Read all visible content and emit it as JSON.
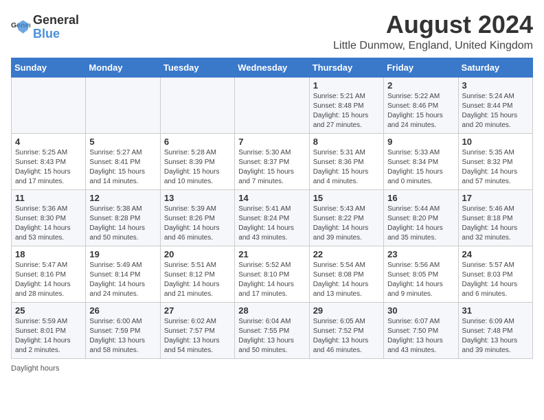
{
  "header": {
    "logo_text_general": "General",
    "logo_text_blue": "Blue",
    "month_year": "August 2024",
    "location": "Little Dunmow, England, United Kingdom"
  },
  "calendar": {
    "days_of_week": [
      "Sunday",
      "Monday",
      "Tuesday",
      "Wednesday",
      "Thursday",
      "Friday",
      "Saturday"
    ],
    "weeks": [
      [
        {
          "day": "",
          "info": ""
        },
        {
          "day": "",
          "info": ""
        },
        {
          "day": "",
          "info": ""
        },
        {
          "day": "",
          "info": ""
        },
        {
          "day": "1",
          "info": "Sunrise: 5:21 AM\nSunset: 8:48 PM\nDaylight: 15 hours and 27 minutes."
        },
        {
          "day": "2",
          "info": "Sunrise: 5:22 AM\nSunset: 8:46 PM\nDaylight: 15 hours and 24 minutes."
        },
        {
          "day": "3",
          "info": "Sunrise: 5:24 AM\nSunset: 8:44 PM\nDaylight: 15 hours and 20 minutes."
        }
      ],
      [
        {
          "day": "4",
          "info": "Sunrise: 5:25 AM\nSunset: 8:43 PM\nDaylight: 15 hours and 17 minutes."
        },
        {
          "day": "5",
          "info": "Sunrise: 5:27 AM\nSunset: 8:41 PM\nDaylight: 15 hours and 14 minutes."
        },
        {
          "day": "6",
          "info": "Sunrise: 5:28 AM\nSunset: 8:39 PM\nDaylight: 15 hours and 10 minutes."
        },
        {
          "day": "7",
          "info": "Sunrise: 5:30 AM\nSunset: 8:37 PM\nDaylight: 15 hours and 7 minutes."
        },
        {
          "day": "8",
          "info": "Sunrise: 5:31 AM\nSunset: 8:36 PM\nDaylight: 15 hours and 4 minutes."
        },
        {
          "day": "9",
          "info": "Sunrise: 5:33 AM\nSunset: 8:34 PM\nDaylight: 15 hours and 0 minutes."
        },
        {
          "day": "10",
          "info": "Sunrise: 5:35 AM\nSunset: 8:32 PM\nDaylight: 14 hours and 57 minutes."
        }
      ],
      [
        {
          "day": "11",
          "info": "Sunrise: 5:36 AM\nSunset: 8:30 PM\nDaylight: 14 hours and 53 minutes."
        },
        {
          "day": "12",
          "info": "Sunrise: 5:38 AM\nSunset: 8:28 PM\nDaylight: 14 hours and 50 minutes."
        },
        {
          "day": "13",
          "info": "Sunrise: 5:39 AM\nSunset: 8:26 PM\nDaylight: 14 hours and 46 minutes."
        },
        {
          "day": "14",
          "info": "Sunrise: 5:41 AM\nSunset: 8:24 PM\nDaylight: 14 hours and 43 minutes."
        },
        {
          "day": "15",
          "info": "Sunrise: 5:43 AM\nSunset: 8:22 PM\nDaylight: 14 hours and 39 minutes."
        },
        {
          "day": "16",
          "info": "Sunrise: 5:44 AM\nSunset: 8:20 PM\nDaylight: 14 hours and 35 minutes."
        },
        {
          "day": "17",
          "info": "Sunrise: 5:46 AM\nSunset: 8:18 PM\nDaylight: 14 hours and 32 minutes."
        }
      ],
      [
        {
          "day": "18",
          "info": "Sunrise: 5:47 AM\nSunset: 8:16 PM\nDaylight: 14 hours and 28 minutes."
        },
        {
          "day": "19",
          "info": "Sunrise: 5:49 AM\nSunset: 8:14 PM\nDaylight: 14 hours and 24 minutes."
        },
        {
          "day": "20",
          "info": "Sunrise: 5:51 AM\nSunset: 8:12 PM\nDaylight: 14 hours and 21 minutes."
        },
        {
          "day": "21",
          "info": "Sunrise: 5:52 AM\nSunset: 8:10 PM\nDaylight: 14 hours and 17 minutes."
        },
        {
          "day": "22",
          "info": "Sunrise: 5:54 AM\nSunset: 8:08 PM\nDaylight: 14 hours and 13 minutes."
        },
        {
          "day": "23",
          "info": "Sunrise: 5:56 AM\nSunset: 8:05 PM\nDaylight: 14 hours and 9 minutes."
        },
        {
          "day": "24",
          "info": "Sunrise: 5:57 AM\nSunset: 8:03 PM\nDaylight: 14 hours and 6 minutes."
        }
      ],
      [
        {
          "day": "25",
          "info": "Sunrise: 5:59 AM\nSunset: 8:01 PM\nDaylight: 14 hours and 2 minutes."
        },
        {
          "day": "26",
          "info": "Sunrise: 6:00 AM\nSunset: 7:59 PM\nDaylight: 13 hours and 58 minutes."
        },
        {
          "day": "27",
          "info": "Sunrise: 6:02 AM\nSunset: 7:57 PM\nDaylight: 13 hours and 54 minutes."
        },
        {
          "day": "28",
          "info": "Sunrise: 6:04 AM\nSunset: 7:55 PM\nDaylight: 13 hours and 50 minutes."
        },
        {
          "day": "29",
          "info": "Sunrise: 6:05 AM\nSunset: 7:52 PM\nDaylight: 13 hours and 46 minutes."
        },
        {
          "day": "30",
          "info": "Sunrise: 6:07 AM\nSunset: 7:50 PM\nDaylight: 13 hours and 43 minutes."
        },
        {
          "day": "31",
          "info": "Sunrise: 6:09 AM\nSunset: 7:48 PM\nDaylight: 13 hours and 39 minutes."
        }
      ]
    ]
  },
  "footer": {
    "text": "Daylight hours"
  }
}
